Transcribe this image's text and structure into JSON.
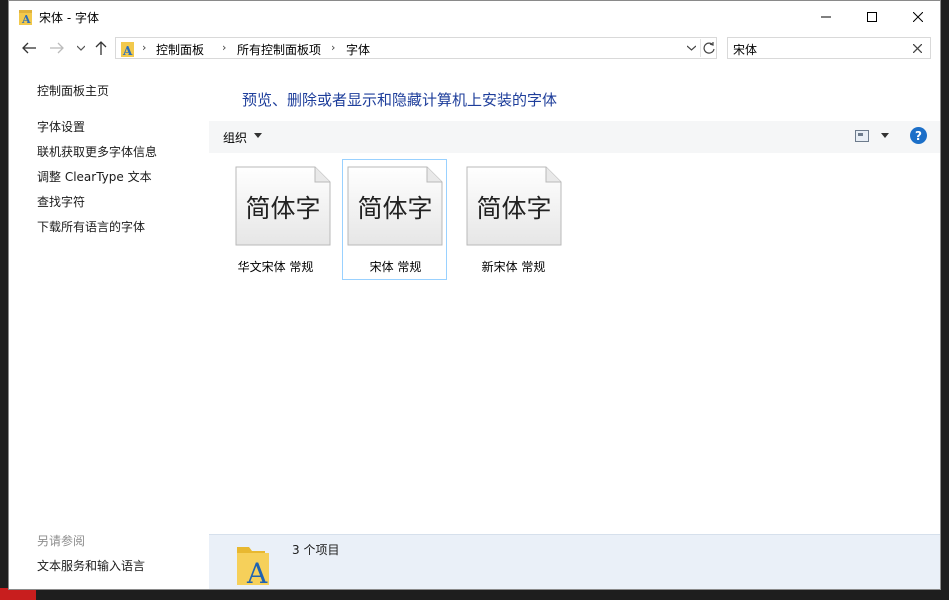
{
  "window": {
    "title": "宋体 - 字体"
  },
  "nav": {
    "breadcrumb": [
      "控制面板",
      "所有控制面板项",
      "字体"
    ],
    "search_value": "宋体"
  },
  "left_pane": {
    "links": [
      "控制面板主页",
      "字体设置",
      "联机获取更多字体信息",
      "调整 ClearType 文本",
      "查找字符",
      "下载所有语言的字体"
    ],
    "see_also_title": "另请参阅",
    "see_also_links": [
      "文本服务和输入语言"
    ]
  },
  "content": {
    "heading": "预览、删除或者显示和隐藏计算机上安装的字体",
    "toolbar": {
      "organize_label": "组织"
    },
    "fonts": [
      {
        "preview": "简体字",
        "label": "华文宋体 常规",
        "selected": false
      },
      {
        "preview": "简体字",
        "label": "宋体 常规",
        "selected": true
      },
      {
        "preview": "简体字",
        "label": "新宋体 常规",
        "selected": false
      }
    ]
  },
  "details": {
    "item_count": "3 个项目"
  },
  "colors": {
    "heading": "#1e3e9b",
    "selection_border": "#99d1ff",
    "details_bg": "#eaf0f8",
    "help_blue": "#1c6fc8"
  },
  "icons": {
    "title": "fonts-folder-icon",
    "back": "arrow-left-icon",
    "forward": "arrow-right-icon",
    "up": "arrow-up-icon",
    "refresh": "refresh-icon",
    "help": "help-icon"
  }
}
